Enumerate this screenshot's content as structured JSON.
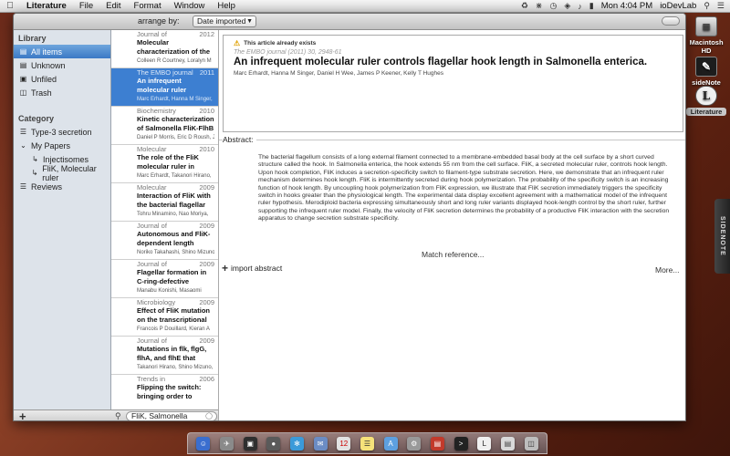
{
  "menubar": {
    "app_name": "Literature",
    "items": [
      "File",
      "Edit",
      "Format",
      "Window",
      "Help"
    ],
    "clock": "Mon 4:04 PM",
    "user": "ioDevLab"
  },
  "desktop": {
    "hd_label": "Macintosh HD",
    "sidenote_label": "sideNote",
    "literature_label": "Literature",
    "sidenote_tab": "SIDENOTE"
  },
  "toolbar": {
    "arrange_label": "arrange by:",
    "arrange_value": "Date imported"
  },
  "sidebar": {
    "library_header": "Library",
    "library_items": [
      "All items",
      "Unknown",
      "Unfiled",
      "Trash"
    ],
    "category_header": "Category",
    "category_items": [
      "Type-3 secretion",
      "My Papers",
      "Injectisomes",
      "FliK, Molecular ruler",
      "Reviews"
    ]
  },
  "list": {
    "entries": [
      {
        "journal": "Journal of",
        "year": "2012",
        "title": "Molecular characterization of the",
        "authors": "Colleen R Courtney, Loralyn M"
      },
      {
        "journal": "The EMBO journal",
        "year": "2011",
        "title": "An infrequent molecular ruler controls flagellar",
        "authors": "Marc Erhardt, Hanna M Singer,"
      },
      {
        "journal": "Biochemistry",
        "year": "2010",
        "title": "Kinetic characterization of Salmonella FliK-FlhB",
        "authors": "Daniel P Morris, Eric D Roush, J"
      },
      {
        "journal": "Molecular",
        "year": "2010",
        "title": "The role of the FliK molecular ruler in hook-",
        "authors": "Marc Erhardt, Takanori Hirano,"
      },
      {
        "journal": "Molecular",
        "year": "2009",
        "title": "Interaction of FliK with the bacterial flagellar",
        "authors": "Tohru Minamino, Nao Moriya,"
      },
      {
        "journal": "Journal of",
        "year": "2009",
        "title": "Autonomous and FliK-dependent length control",
        "authors": "Noriko Takahashi, Shino Mizuno,"
      },
      {
        "journal": "Journal of",
        "year": "2009",
        "title": "Flagellar formation in C-ring-defective mutants by",
        "authors": "Manabu Konishi, Masaomi"
      },
      {
        "journal": "Microbiology",
        "year": "2009",
        "title": "Effect of FliK mutation on the transcriptional",
        "authors": "Francois P Douillard, Kieran A"
      },
      {
        "journal": "Journal of",
        "year": "2009",
        "title": "Mutations in flk, flgG, flhA, and flhE that affect",
        "authors": "Takanori Hirano, Shino Mizuno,"
      },
      {
        "journal": "Trends in",
        "year": "2006",
        "title": "Flipping the switch: bringing order to flagellar",
        "authors": ""
      }
    ],
    "search_value": "FliK, Salmonella"
  },
  "detail": {
    "warning": "This article already exists",
    "meta": "The EMBO journal (2011) 30, 2948-61",
    "title": "An infrequent molecular ruler controls flagellar hook length in Salmonella enterica.",
    "authors": "Marc Erhardt, Hanna M Singer, Daniel H Wee, James P Keener, Kelly T Hughes",
    "abstract_label": "Abstract:",
    "abstract": "The bacterial flagellum consists of a long external filament connected to a membrane-embedded basal body at the cell surface by a short curved structure called the hook. In Salmonella enterica, the hook extends 55 nm from the cell surface. FliK, a secreted molecular ruler, controls hook length. Upon hook completion, FliK induces a secretion-specificity switch to filament-type substrate secretion. Here, we demonstrate that an infrequent ruler mechanism determines hook length. FliK is intermittently secreted during hook polymerization. The probability of the specificity switch is an increasing function of hook length. By uncoupling hook polymerization from FliK expression, we illustrate that FliK secretion immediately triggers the specificity switch in hooks greater than the physiological length. The experimental data display excellent agreement with a mathematical model of the infrequent ruler hypothesis. Merodiploid bacteria expressing simultaneously short and long ruler variants displayed hook-length control by the short ruler, further supporting the infrequent ruler model. Finally, the velocity of FliK secretion determines the probability of a productive FliK interaction with the secretion apparatus to change secretion substrate specificity.",
    "match_reference": "Match reference...",
    "import_abstract": "import abstract",
    "more": "More..."
  }
}
